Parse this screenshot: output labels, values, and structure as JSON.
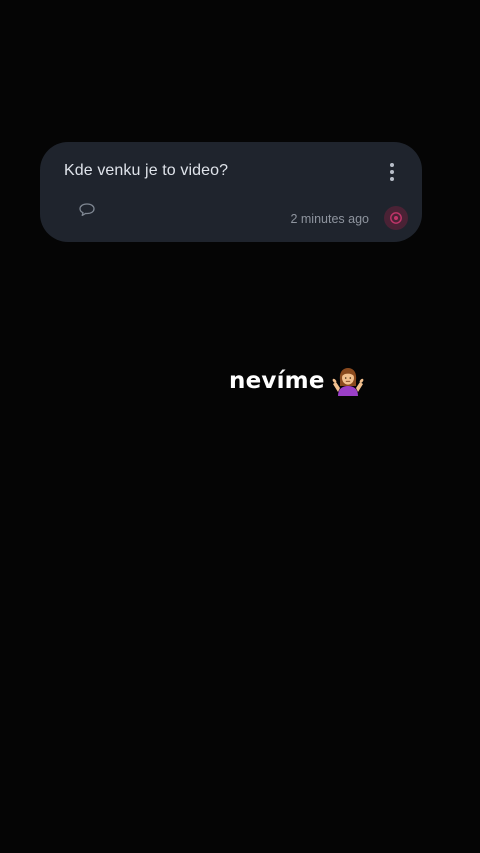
{
  "question_card": {
    "text": "Kde venku je to video?",
    "timestamp": "2 minutes ago",
    "icons": {
      "more": "more-vertical-icon",
      "comment": "comment-icon",
      "reaction": "reaction-icon"
    }
  },
  "caption": {
    "text": "nevíme",
    "emoji": "woman-shrugging"
  },
  "colors": {
    "background": "#050505",
    "card": "#1f242d",
    "accent": "#c0356a"
  }
}
